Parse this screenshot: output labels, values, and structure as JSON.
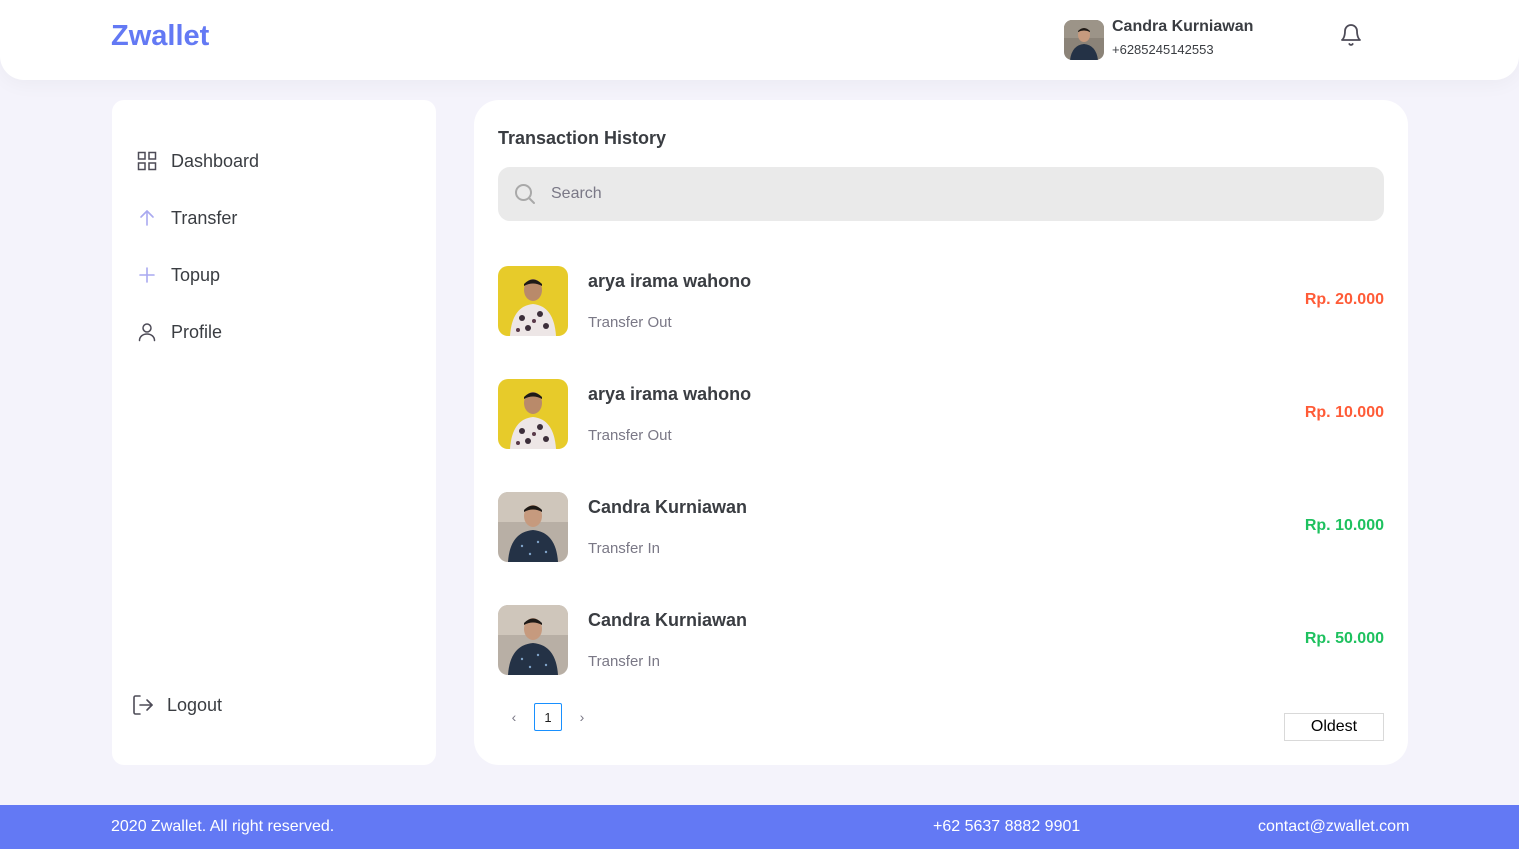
{
  "header": {
    "brand": "Zwallet",
    "user_name": "Candra Kurniawan",
    "user_phone": "+6285245142553",
    "bell_icon": "bell-icon"
  },
  "sidebar": {
    "items": [
      {
        "label": "Dashboard",
        "icon": "grid-icon"
      },
      {
        "label": "Transfer",
        "icon": "arrow-up-icon"
      },
      {
        "label": "Topup",
        "icon": "plus-icon"
      },
      {
        "label": "Profile",
        "icon": "user-icon"
      }
    ],
    "logout": {
      "label": "Logout",
      "icon": "logout-icon"
    }
  },
  "main": {
    "title": "Transaction History",
    "search_placeholder": "Search",
    "transactions": [
      {
        "name": "arya irama wahono",
        "type": "Transfer Out",
        "amount": "Rp. 20.000",
        "color": "#FF5B37"
      },
      {
        "name": "arya irama wahono",
        "type": "Transfer Out",
        "amount": "Rp. 10.000",
        "color": "#FF5B37"
      },
      {
        "name": "Candra Kurniawan",
        "type": "Transfer In",
        "amount": "Rp. 10.000",
        "color": "#1EC15F"
      },
      {
        "name": "Candra Kurniawan",
        "type": "Transfer In",
        "amount": "Rp. 50.000",
        "color": "#1EC15F"
      }
    ],
    "pagination": {
      "prev": "‹",
      "current": "1",
      "next": "›"
    },
    "sort_label": "Oldest"
  },
  "footer": {
    "copyright": "2020 Zwallet. All right reserved.",
    "phone": "+62 5637 8882 9901",
    "email": "contact@zwallet.com"
  },
  "colors": {
    "accent": "#6379F4",
    "out": "#FF5B37",
    "in": "#1EC15F",
    "background": "#F4F3FB"
  }
}
